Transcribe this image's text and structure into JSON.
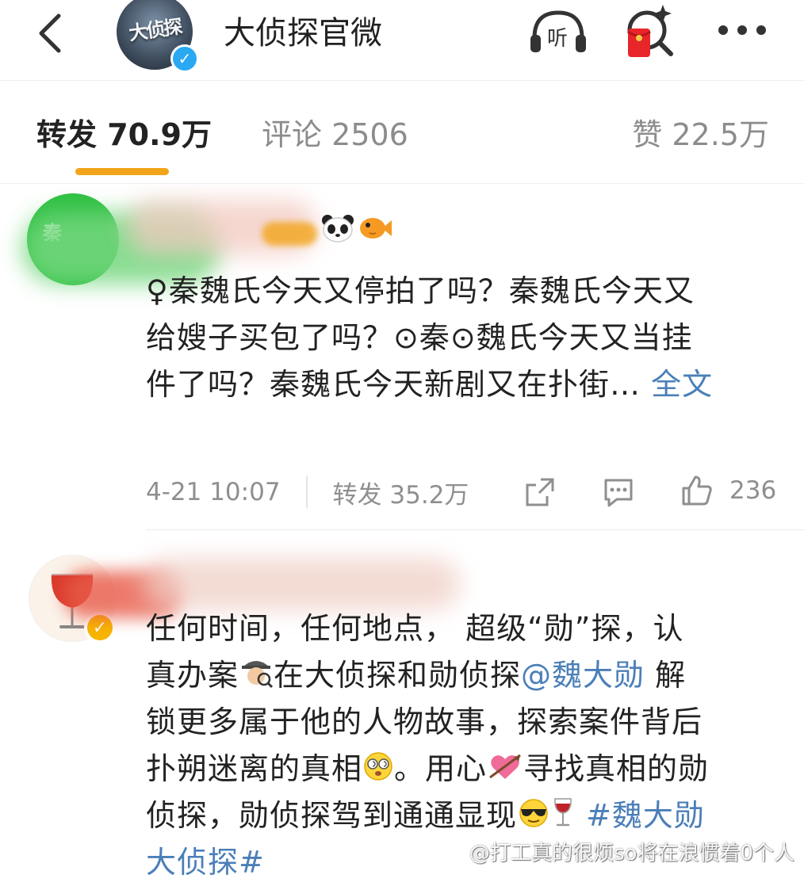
{
  "header": {
    "title": "大侦探官微",
    "listen_label": "听",
    "avatar_logo_text": "大侦探"
  },
  "tabs": [
    {
      "label": "转发 70.9万"
    },
    {
      "label": "评论 2506"
    },
    {
      "label": "赞 22.5万"
    }
  ],
  "comments": [
    {
      "avatar_label": "秦",
      "text_line1": "♀秦魏氏今天又停拍了吗？秦魏氏今天又",
      "text_line2": "给嫂子买包了吗？⊙秦⊙魏氏今天又当挂",
      "text_line3": "件了吗？秦魏氏今天新剧又在扑街… ",
      "full_text_link": "全文",
      "timestamp": "4-21 10:07",
      "repost_count": "转发 35.2万",
      "like_count": "236"
    },
    {
      "line1": "任何时间，任何地点， 超级“勋”探，认",
      "line2_a": "真办案",
      "line2_b": "在大侦探和勋侦探",
      "mention": "@魏大勋",
      "line2_c": " 解",
      "line3": "锁更多属于他的人物故事，探索案件背后",
      "line4_a": "扑朔迷离的真相",
      "line4_b": "。用心",
      "line4_c": "寻找真相的勋",
      "line5_a": "侦探，勋侦探驾到通通显现",
      "hashtag_a": " #魏大勋",
      "hashtag_b": "大侦探#"
    }
  ],
  "watermark": "@打工真的很烦so将在浪惯着0个人",
  "colors": {
    "accent_orange": "#f2a51a",
    "link_blue": "#4b7fb8",
    "verified_yellow": "#f7b500",
    "verified_blue": "#2aa8f2"
  }
}
